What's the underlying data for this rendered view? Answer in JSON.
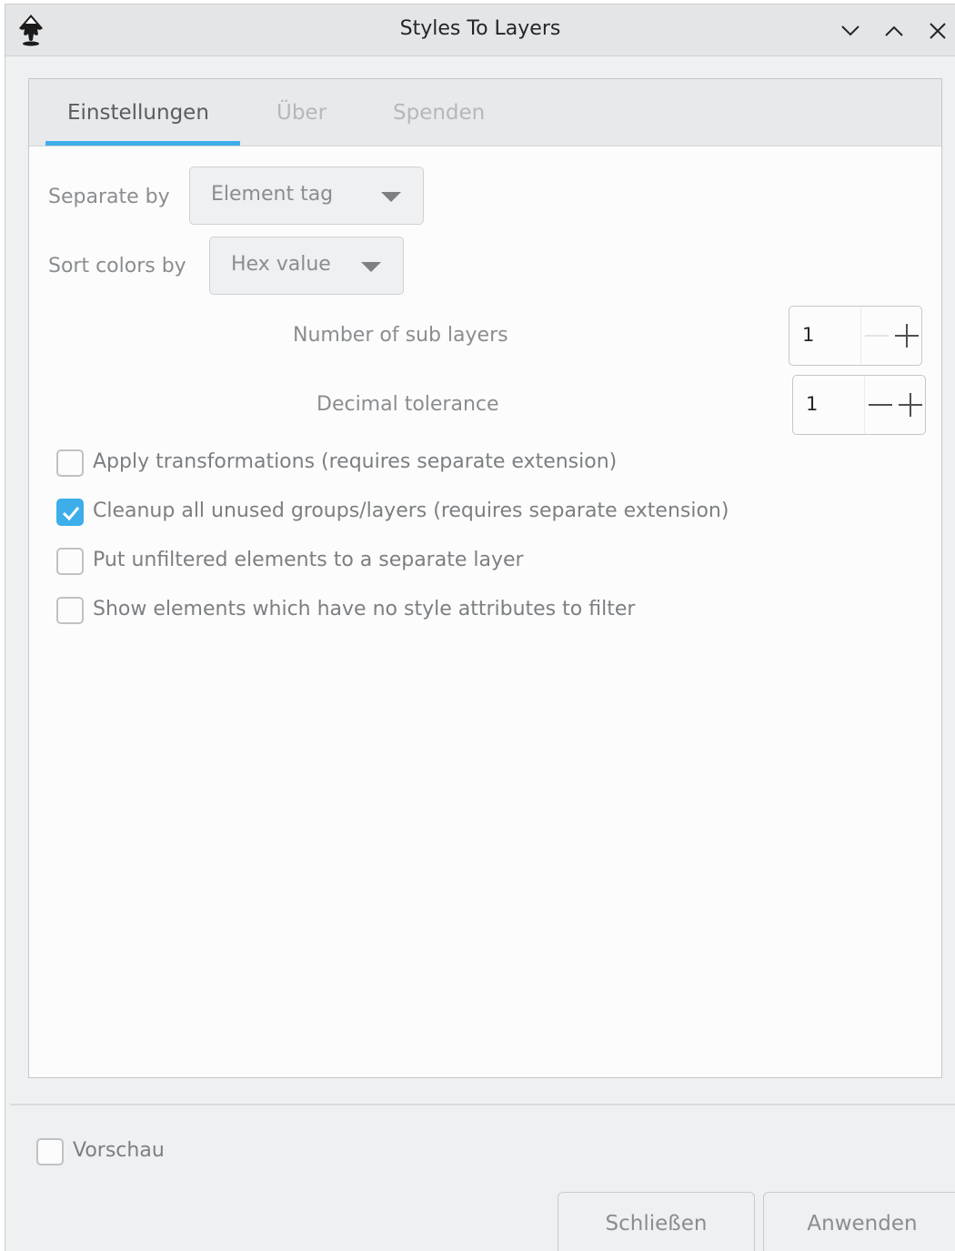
{
  "window": {
    "title": "Styles To Layers",
    "controls": [
      "chevron-down-icon",
      "chevron-up-icon",
      "close-icon"
    ]
  },
  "tabs": [
    {
      "label": "Einstellungen",
      "active": true
    },
    {
      "label": "Über",
      "active": false
    },
    {
      "label": "Spenden",
      "active": false
    }
  ],
  "settings": {
    "separate_by": {
      "label": "Separate by",
      "value": "Element tag"
    },
    "sort_colors_by": {
      "label": "Sort colors by",
      "value": "Hex value"
    },
    "sub_layers": {
      "label": "Number of sub layers",
      "value": "1"
    },
    "decimal_tolerance": {
      "label": "Decimal tolerance",
      "value": "1"
    }
  },
  "options": [
    {
      "label": "Apply transformations (requires separate extension)",
      "checked": false
    },
    {
      "label": "Cleanup all unused groups/layers (requires separate extension)",
      "checked": true
    },
    {
      "label": "Put unfiltered elements to a separate layer",
      "checked": false
    },
    {
      "label": "Show elements which have no style attributes to filter",
      "checked": false
    }
  ],
  "footer": {
    "preview_label": "Vorschau",
    "preview_checked": false,
    "close_label": "Schließen",
    "apply_label": "Anwenden"
  },
  "colors": {
    "accent": "#3daee9",
    "window_bg": "#eff0f1",
    "panel_bg": "#fcfcfc"
  }
}
